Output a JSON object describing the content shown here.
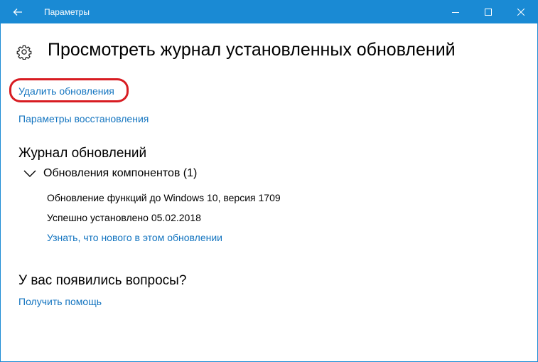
{
  "window": {
    "title": "Параметры",
    "accent_color": "#1a8ad4",
    "highlight_color": "#d81c22",
    "link_color": "#1475c0"
  },
  "titlebar": {
    "back_icon": "back-arrow-icon",
    "minimize_icon": "minimize-icon",
    "maximize_icon": "maximize-icon",
    "close_icon": "close-icon"
  },
  "header": {
    "icon": "gear-icon",
    "title": "Просмотреть журнал установленных обновлений"
  },
  "links": {
    "uninstall": "Удалить обновления",
    "recovery": "Параметры восстановления"
  },
  "history": {
    "heading": "Журнал обновлений",
    "groups": [
      {
        "label": "Обновления компонентов (1)",
        "expanded": true,
        "items": [
          {
            "name": "Обновление функций до Windows 10, версия 1709",
            "status": "Успешно установлено 05.02.2018",
            "link": "Узнать, что нового в этом обновлении"
          }
        ]
      }
    ]
  },
  "questions": {
    "heading": "У вас появились вопросы?",
    "help_link": "Получить помощь"
  }
}
